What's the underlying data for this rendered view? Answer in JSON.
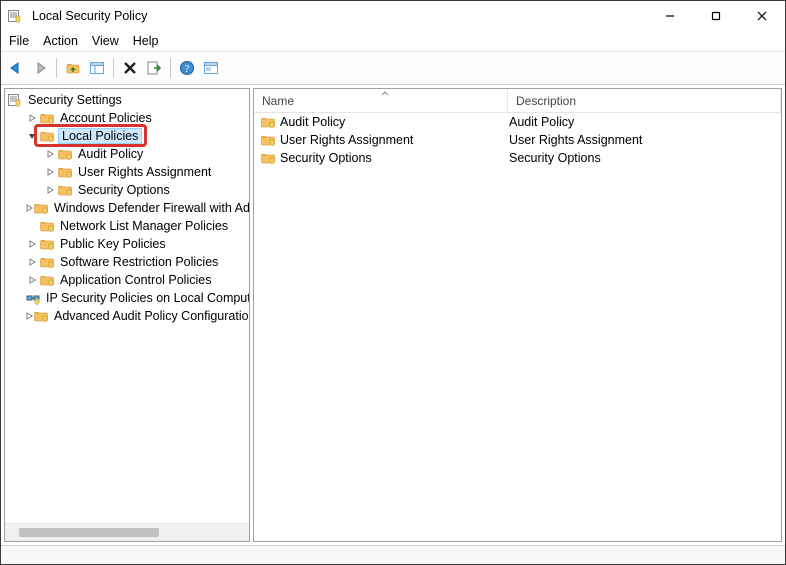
{
  "window": {
    "title": "Local Security Policy"
  },
  "menu": {
    "file": "File",
    "action": "Action",
    "view": "View",
    "help": "Help"
  },
  "tree": {
    "root": "Security Settings",
    "items": [
      {
        "label": "Account Policies",
        "expandable": true
      },
      {
        "label": "Local Policies",
        "expandable": true,
        "expanded": true,
        "selected": true,
        "highlighted": true,
        "children": [
          {
            "label": "Audit Policy",
            "expandable": true
          },
          {
            "label": "User Rights Assignment",
            "expandable": true
          },
          {
            "label": "Security Options",
            "expandable": true
          }
        ]
      },
      {
        "label": "Windows Defender Firewall with Advanced Security",
        "expandable": true
      },
      {
        "label": "Network List Manager Policies",
        "expandable": false
      },
      {
        "label": "Public Key Policies",
        "expandable": true
      },
      {
        "label": "Software Restriction Policies",
        "expandable": true
      },
      {
        "label": "Application Control Policies",
        "expandable": true
      },
      {
        "label": "IP Security Policies on Local Computer",
        "expandable": false,
        "icon": "ipsec"
      },
      {
        "label": "Advanced Audit Policy Configuration",
        "expandable": true
      }
    ]
  },
  "list": {
    "columns": {
      "name": "Name",
      "description": "Description"
    },
    "rows": [
      {
        "name": "Audit Policy",
        "description": "Audit Policy"
      },
      {
        "name": "User Rights Assignment",
        "description": "User Rights Assignment"
      },
      {
        "name": "Security Options",
        "description": "Security Options"
      }
    ]
  }
}
